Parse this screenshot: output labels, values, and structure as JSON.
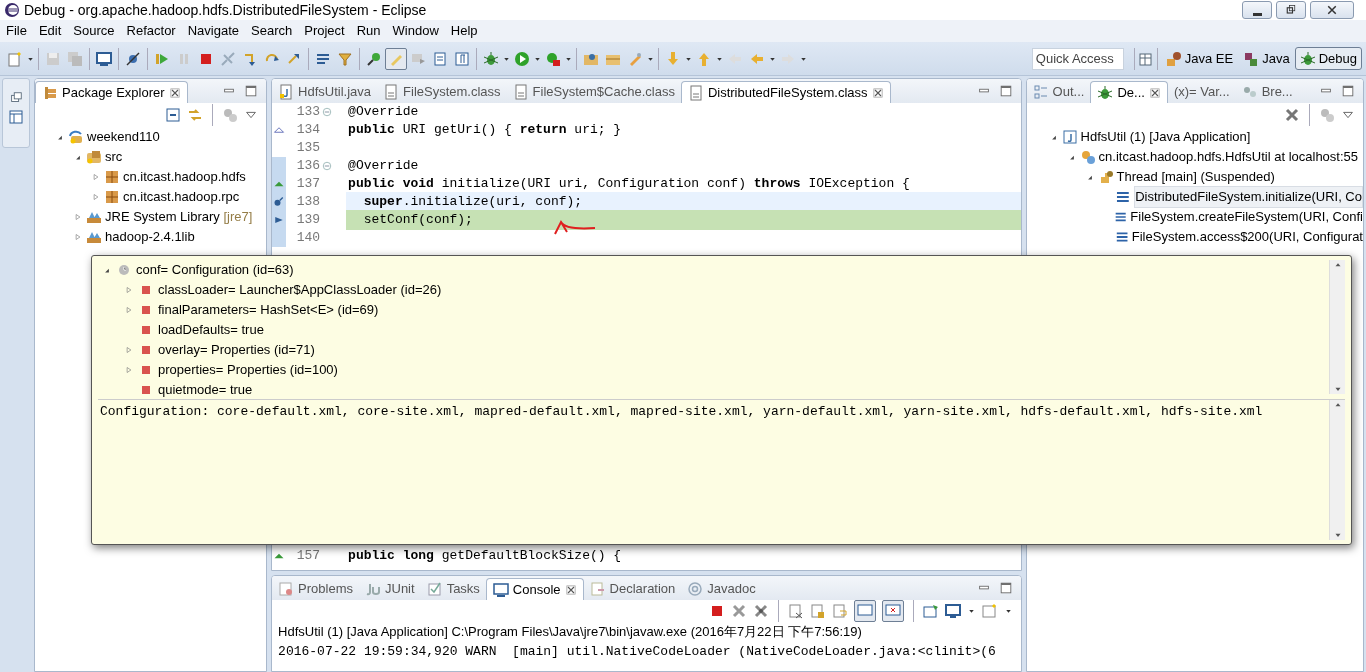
{
  "window": {
    "title": "Debug - org.apache.hadoop.hdfs.DistributedFileSystem - Eclipse"
  },
  "menu": [
    "File",
    "Edit",
    "Source",
    "Refactor",
    "Navigate",
    "Search",
    "Project",
    "Run",
    "Window",
    "Help"
  ],
  "quick_access": {
    "placeholder": "Quick Access"
  },
  "perspectives": [
    {
      "label": "Java EE",
      "kind": "javaee",
      "selected": false
    },
    {
      "label": "Java",
      "kind": "java",
      "selected": false
    },
    {
      "label": "Debug",
      "kind": "debug",
      "selected": true
    }
  ],
  "package_explorer": {
    "title": "Package Explorer",
    "tree": [
      {
        "label": "weekend110",
        "kind": "project",
        "expanded": true,
        "children": [
          {
            "label": "src",
            "kind": "folder",
            "expanded": true,
            "children": [
              {
                "label": "cn.itcast.hadoop.hdfs",
                "kind": "package",
                "expanded": false
              },
              {
                "label": "cn.itcast.hadoop.rpc",
                "kind": "package",
                "expanded": false
              }
            ]
          },
          {
            "label": "JRE System Library",
            "decoration": "[jre7]",
            "kind": "library",
            "expanded": false
          },
          {
            "label": "hadoop-2.4.1lib",
            "kind": "library",
            "expanded": false
          }
        ]
      }
    ]
  },
  "editor": {
    "tabs": [
      {
        "label": "HdfsUtil.java",
        "kind": "java",
        "selected": false
      },
      {
        "label": "FileSystem.class",
        "kind": "class",
        "selected": false
      },
      {
        "label": "FileSystem$Cache.class",
        "kind": "class",
        "selected": false
      },
      {
        "label": "DistributedFileSystem.class",
        "kind": "class",
        "selected": true
      }
    ],
    "lines": [
      {
        "number": "133",
        "code": "@Override",
        "kind": "fold",
        "current_line": false,
        "suspended": false
      },
      {
        "number": "134",
        "code": "**public** URI getUri() { **return** uri; }",
        "kind": "override",
        "current_line": false,
        "suspended": false
      },
      {
        "number": "135",
        "kind": "plain",
        "current_line": false,
        "suspended": false
      },
      {
        "number": "136",
        "code": "@Override",
        "kind": "fold",
        "current_line": false,
        "suspended": false
      },
      {
        "number": "137",
        "code": "**public** **void** initialize(URI uri, Configuration conf) **throws** IOException {",
        "kind": "implements",
        "current_line": false,
        "suspended": false
      },
      {
        "number": "138",
        "code": "  **super**.initialize(uri, conf);",
        "kind": "breakpoint",
        "current_line": true,
        "suspended": false
      },
      {
        "number": "139",
        "code": "  setConf(conf);",
        "kind": "instruction",
        "current_line": false,
        "suspended": true
      },
      {
        "number": "140",
        "kind": "plain",
        "current_line": false,
        "suspended": false
      },
      {
        "number": "157",
        "code": "**public** **long** getDefaultBlockSize() {",
        "kind": "implements",
        "current_line": false,
        "suspended": false
      }
    ]
  },
  "inspect_popup": {
    "tree": [
      {
        "label": "conf= Configuration  (id=63)",
        "expanded": true,
        "children": [
          {
            "label": "classLoader= Launcher$AppClassLoader  (id=26)",
            "expandable": true
          },
          {
            "label": "finalParameters= HashSet<E>  (id=69)",
            "expandable": true
          },
          {
            "label": "loadDefaults= true",
            "expandable": false
          },
          {
            "label": "overlay= Properties  (id=71)",
            "expandable": true
          },
          {
            "label": "properties= Properties  (id=100)",
            "expandable": true
          },
          {
            "label": "quietmode= true",
            "expandable": false
          }
        ]
      }
    ],
    "detail": "Configuration: core-default.xml, core-site.xml, mapred-default.xml, mapred-site.xml, yarn-default.xml, yarn-site.xml, hdfs-default.xml, hdfs-site.xml"
  },
  "debug_view": {
    "tabs": [
      {
        "label": "Out...",
        "kind": "outline",
        "selected": false
      },
      {
        "label": "De...",
        "kind": "debug",
        "selected": true
      },
      {
        "label": "(x)= Var...",
        "kind": "variables",
        "selected": false
      },
      {
        "label": "Bre...",
        "kind": "breakpoints",
        "selected": false
      }
    ],
    "tree": [
      {
        "label": "HdfsUtil (1) [Java Application]",
        "kind": "launch",
        "expanded": true,
        "children": [
          {
            "label": "cn.itcast.hadoop.hdfs.HdfsUtil at localhost:55",
            "kind": "target",
            "expanded": true,
            "children": [
              {
                "label": "Thread [main] (Suspended)",
                "kind": "thread",
                "expanded": true,
                "children": [
                  {
                    "label": "DistributedFileSystem.initialize(URI, Co",
                    "kind": "frame",
                    "selected": true
                  },
                  {
                    "label": "FileSystem.createFileSystem(URI, Confi",
                    "kind": "frame",
                    "selected": false
                  },
                  {
                    "label": "FileSystem.access$200(URI, Configurat",
                    "kind": "frame",
                    "selected": false
                  }
                ]
              }
            ]
          }
        ]
      }
    ]
  },
  "console": {
    "tabs": [
      {
        "label": "Problems",
        "kind": "problems",
        "selected": false
      },
      {
        "label": "JUnit",
        "kind": "junit",
        "selected": false
      },
      {
        "label": "Tasks",
        "kind": "tasks",
        "selected": false
      },
      {
        "label": "Console",
        "kind": "console",
        "selected": true
      },
      {
        "label": "Declaration",
        "kind": "declaration",
        "selected": false
      },
      {
        "label": "Javadoc",
        "kind": "javadoc",
        "selected": false
      }
    ],
    "process": "HdfsUtil (1) [Java Application] C:\\Program Files\\Java\\jre7\\bin\\javaw.exe (2016年7月22日 下午7:56:19)",
    "lines": [
      "2016-07-22 19:59:34,920 WARN  [main] util.NativeCodeLoader (NativeCodeLoader.java:<clinit>(6"
    ]
  }
}
